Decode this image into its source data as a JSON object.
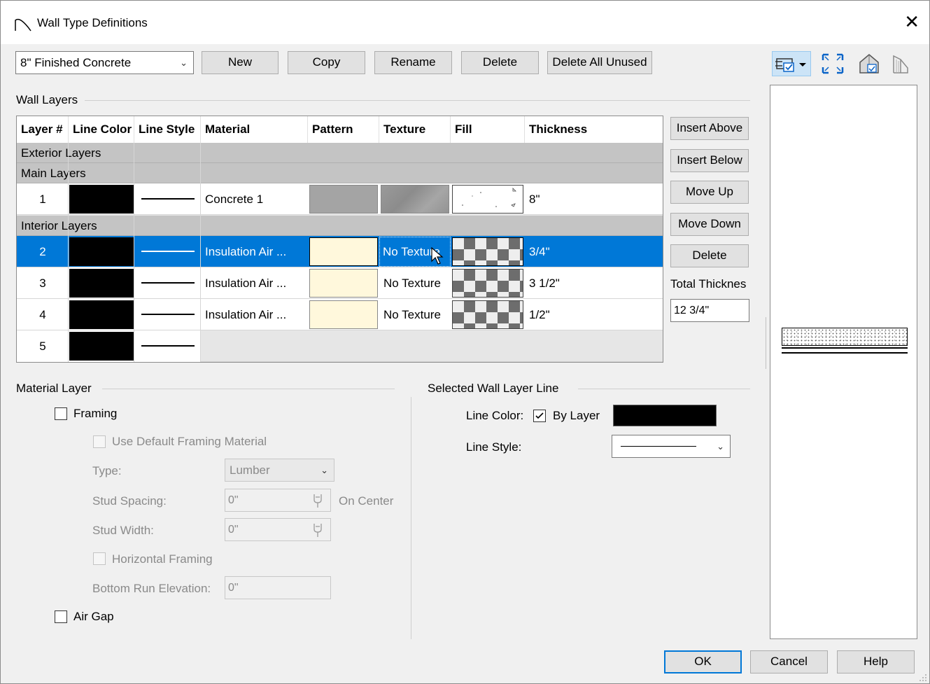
{
  "window": {
    "title": "Wall Type Definitions",
    "close_glyph": "✕"
  },
  "toolbar": {
    "wall_type_selected": "8\" Finished Concrete",
    "new_label": "New",
    "copy_label": "Copy",
    "rename_label": "Rename",
    "delete_label": "Delete",
    "delete_all_unused_label": "Delete All Unused"
  },
  "wall_layers": {
    "group_label": "Wall Layers",
    "columns": [
      "Layer #",
      "Line Color",
      "Line Style",
      "Material",
      "Pattern",
      "Texture",
      "Fill",
      "Thickness"
    ],
    "sections": {
      "exterior": "Exterior Layers",
      "main": "Main Layers",
      "interior": "Interior Layers"
    },
    "rows": [
      {
        "num": "1",
        "material": "Concrete 1",
        "texture": "",
        "thickness": "8\"",
        "pattern_color": "#a4a4a4",
        "selected": false
      },
      {
        "num": "2",
        "material": "Insulation  Air ...",
        "texture": "No Texture",
        "thickness": "3/4\"",
        "pattern_color": "#fff8dc",
        "selected": true
      },
      {
        "num": "3",
        "material": "Insulation  Air ...",
        "texture": "No Texture",
        "thickness": "3 1/2\"",
        "pattern_color": "#fff8dc",
        "selected": false
      },
      {
        "num": "4",
        "material": "Insulation  Air ...",
        "texture": "No Texture",
        "thickness": "1/2\"",
        "pattern_color": "#fff8dc",
        "selected": false
      },
      {
        "num": "5",
        "material": "",
        "texture": "",
        "thickness": "",
        "pattern_color": "",
        "selected": false
      }
    ]
  },
  "side_buttons": {
    "insert_above": "Insert Above",
    "insert_below": "Insert Below",
    "move_up": "Move Up",
    "move_down": "Move Down",
    "delete": "Delete",
    "total_thickness_label": "Total Thicknes",
    "total_thickness_value": "12 3/4\""
  },
  "material_layer": {
    "group_label": "Material Layer",
    "framing_label": "Framing",
    "use_default_label": "Use Default Framing Material",
    "type_label": "Type:",
    "type_value": "Lumber",
    "stud_spacing_label": "Stud Spacing:",
    "stud_spacing_value": "0\"",
    "on_center_label": "On Center",
    "stud_width_label": "Stud Width:",
    "stud_width_value": "0\"",
    "horizontal_framing_label": "Horizontal Framing",
    "bottom_run_label": "Bottom Run Elevation:",
    "bottom_run_value": "0\"",
    "air_gap_label": "Air Gap"
  },
  "selected_line": {
    "group_label": "Selected Wall Layer Line",
    "line_color_label": "Line Color:",
    "by_layer_label": "By Layer",
    "by_layer_checked": true,
    "line_style_label": "Line Style:",
    "line_color_value": "#000000"
  },
  "footer": {
    "ok_label": "OK",
    "cancel_label": "Cancel",
    "help_label": "Help"
  },
  "colors": {
    "accent": "#0078d7",
    "section_bg": "#c4c4c4"
  }
}
